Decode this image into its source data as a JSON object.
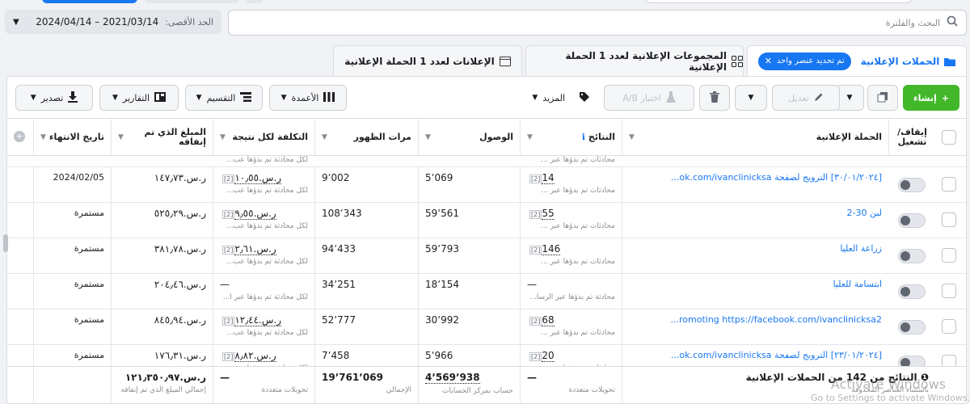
{
  "date_filter": {
    "label": "الحد الأقصى:",
    "value": "2024/04/14 – 2021/03/14"
  },
  "search": {
    "placeholder": "البحث والفلترة"
  },
  "tabs": {
    "campaigns": "الحملات الإعلانية",
    "selected_chip": "تم تحديد عنصر واحد",
    "adsets": "المجموعات الإعلانية لعدد 1 الحملة الإعلانية",
    "ads": "الإعلانات لعدد 1 الحملة الإعلانية"
  },
  "toolbar": {
    "create": "إنشاء",
    "edit": "تعديل",
    "ab_test": "اختبار A/B",
    "more": "المزيد",
    "columns": "الأعمدة",
    "breakdown": "التقسيم",
    "reports": "التقارير",
    "export": "تصدير"
  },
  "columns": {
    "toggle": "إيقاف/ تشغيل",
    "campaign": "الحملة الإعلانية",
    "results": "النتائج",
    "reach": "الوصول",
    "impressions": "مرات الظهور",
    "cost_per_result": "التكلفة لكل نتيجة",
    "amount_spent": "المبلغ الذي تم إنفاقه",
    "end_date": "تاريخ الانتهاء"
  },
  "partial_top": {
    "results_sub": "محادثات تم بدؤها عبر ...",
    "cost_sub": "لكل محادثة تم بدؤها عب..."
  },
  "rows": [
    {
      "campaign": "[٣٠/٠١/٢٠٢٤] الترويج لصفحة ok.com/ivanclinicksa...",
      "results": "14",
      "results_sub": "محادثات تم بدؤها عبر ...",
      "reach": "5٬069",
      "impressions": "9٬002",
      "cost": "ر.س.١٠٫٥٥",
      "cost_sub": "لكل محادثة تم بدؤها عب...",
      "spent": "ر.س.١٤٧٫٧٣",
      "end": "2024/02/05"
    },
    {
      "campaign": "لبن 30-2",
      "results": "55",
      "results_sub": "محادثات تم بدؤها عبر ...",
      "reach": "59٬561",
      "impressions": "108٬343",
      "cost": "ر.س.٩٫٥٥",
      "cost_sub": "لكل محادثة تم بدؤها عب...",
      "spent": "ر.س.٥٢٥٫٢٩",
      "end": "مستمرة"
    },
    {
      "campaign": "زراعة العليا",
      "results": "146",
      "results_sub": "محادثات تم بدؤها عبر ...",
      "reach": "59٬793",
      "impressions": "94٬433",
      "cost": "ر.س.٢٫٦١",
      "cost_sub": "لكل محادثة تم بدؤها عب...",
      "spent": "ر.س.٣٨١٫٧٨",
      "end": "مستمرة"
    },
    {
      "campaign": "ابتسامة للعليا",
      "results": "—",
      "results_sub": "محادثة تم بدؤها عبر الرسا...",
      "reach": "18٬154",
      "impressions": "34٬251",
      "cost": "—",
      "cost_sub": "لكل محادثة تم بدؤها عبر ا...",
      "spent": "ر.س.٢٠٤٫٤٦",
      "end": "مستمرة"
    },
    {
      "campaign": "romoting https://facebook.com/ivanclinicksa2...",
      "results": "68",
      "results_sub": "محادثات تم بدؤها عبر ...",
      "reach": "30٬992",
      "impressions": "52٬777",
      "cost": "ر.س.١٢٫٤٤",
      "cost_sub": "لكل محادثة تم بدؤها عب...",
      "spent": "ر.س.٨٤٥٫٩٤",
      "end": "مستمرة"
    },
    {
      "campaign": "[٢٣/٠١/٢٠٢٤] الترويج لصفحة ok.com/ivanclinicksa...",
      "results": "20",
      "results_sub": "محادثات تم بدؤها عبر ...",
      "reach": "5٬966",
      "impressions": "7٬458",
      "cost": "ر.س.٨٫٨٢",
      "cost_sub": "لكل محادثة تم بدؤها عب...",
      "spent": "ر.س.١٧٦٫٣١",
      "end": "مستمرة"
    }
  ],
  "footer": {
    "title": "النتائج من 142 من الحملات الإعلانية",
    "title_sub": "باستثناء العناصر المحذوفة",
    "results": "—",
    "results_sub": "تحويلات متعددة",
    "reach": "4٬569٬938",
    "reach_sub": "حساب بمركز الحسابات",
    "impressions": "19٬761٬069",
    "impressions_sub": "الإجمالي",
    "cost": "—",
    "cost_sub": "تحويلات متعددة",
    "spent": "ر.س.١٢١٫٣٥٠٫٩٧",
    "spent_sub": "إجمالي المبلغ الذي تم إنفاقه"
  },
  "watermark": {
    "title": "Activate Windows",
    "sub": "Go to Settings to activate Windows."
  },
  "colors": {
    "accent": "#1877f2",
    "create": "#42b72a"
  }
}
